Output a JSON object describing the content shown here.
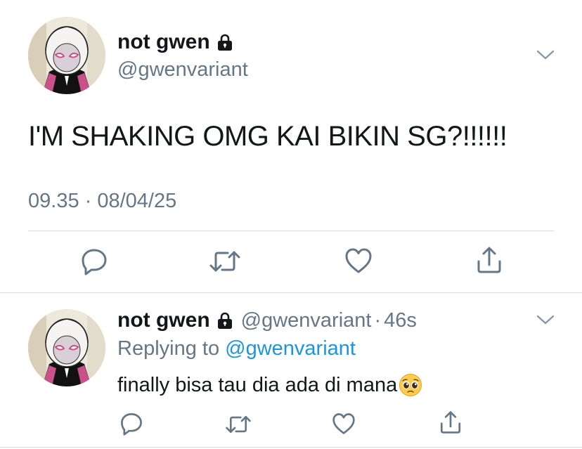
{
  "main_tweet": {
    "display_name": "not gwen",
    "handle": "@gwenvariant",
    "protected_icon": "lock-icon",
    "text": "I'M SHAKING OMG KAI BIKIN SG?!!!!!!",
    "timestamp": "09.35 · 08/04/25",
    "actions": [
      "reply-icon",
      "retweet-icon",
      "like-icon",
      "share-icon"
    ]
  },
  "reply_tweet": {
    "display_name": "not gwen",
    "handle": "@gwenvariant",
    "separator": "·",
    "age": "46s",
    "replying_prefix": "Replying to ",
    "replying_to": "@gwenvariant",
    "text": "finally bisa tau dia ada di mana",
    "emoji": "pleading-face-emoji",
    "actions": [
      "reply-icon",
      "retweet-icon",
      "like-icon",
      "share-icon"
    ]
  },
  "colors": {
    "text_primary": "#14171a",
    "text_secondary": "#657786",
    "link": "#1b95e0",
    "divider": "#d8dde1",
    "icon": "#657786"
  }
}
